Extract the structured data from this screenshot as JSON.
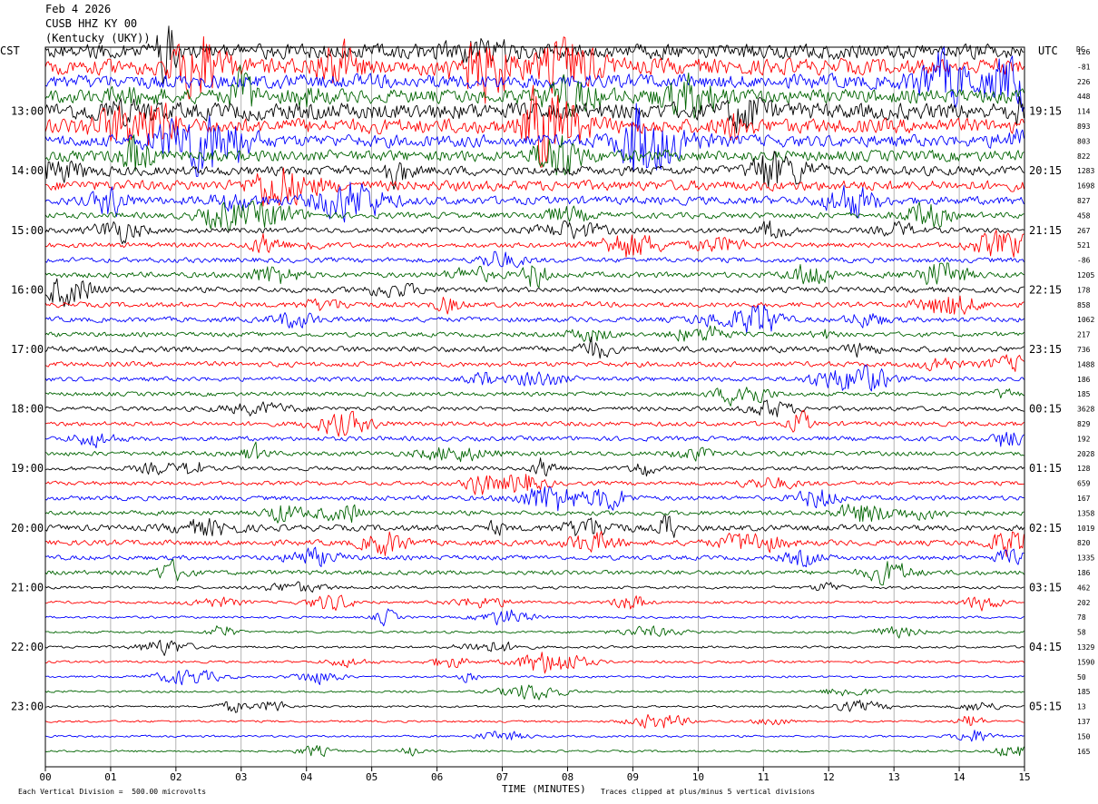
{
  "header": {
    "line1": "Feb 4 2026",
    "line2": "CUSB HHZ KY 00",
    "line3": "(Kentucky (UKY))"
  },
  "left_zone_label": "CST",
  "right_zone_label": "UTC",
  "dc_label": "DC",
  "footer": {
    "scale_note": "Each Vertical Division =  500.00 microvolts",
    "x_title": "TIME (MINUTES)",
    "clip_note": "Traces clipped at plus/minus 5 vertical divisions"
  },
  "chart_data": {
    "type": "line",
    "title": "",
    "xlabel": "TIME (MINUTES)",
    "xlim": [
      0,
      15
    ],
    "x_ticks": [
      "00",
      "01",
      "02",
      "03",
      "04",
      "05",
      "06",
      "07",
      "08",
      "09",
      "10",
      "11",
      "12",
      "13",
      "14",
      "15"
    ],
    "left_hour_labels": [
      "13:00",
      "14:00",
      "15:00",
      "16:00",
      "17:00",
      "18:00",
      "19:00",
      "20:00",
      "21:00",
      "22:00",
      "23:00"
    ],
    "right_hour_labels": [
      "19:15",
      "20:15",
      "21:15",
      "22:15",
      "23:15",
      "00:15",
      "01:15",
      "02:15",
      "03:15",
      "04:15",
      "05:15"
    ],
    "trace_colors_cycle": [
      "#000000",
      "#ff0000",
      "#0000ff",
      "#006400"
    ],
    "first_trace_color": "#000000",
    "rows_per_hour": 4,
    "dc_offsets": [
      "126",
      "-81",
      "226",
      "448",
      "114",
      "893",
      "803",
      "822",
      "1283",
      "1698",
      "827",
      "458",
      "267",
      "521",
      "-86",
      "1205",
      "178",
      "858",
      "1062",
      "217",
      "736",
      "1488",
      "186",
      "185",
      "3628",
      "829",
      "192",
      "2028",
      "128",
      "659",
      "167",
      "1358",
      "1019",
      "820",
      "1335",
      "186",
      "462",
      "202",
      "78",
      "58",
      "1329",
      "1590",
      "50",
      "185",
      "13",
      "137",
      "150",
      "165"
    ],
    "activity_level": [
      3.2,
      3.4,
      3.0,
      3.0,
      3.6,
      3.2,
      2.6,
      2.4,
      2.0,
      2.2,
      1.8,
      1.3,
      1.2,
      1.1,
      1.1,
      1.2,
      1.2,
      1.1,
      1.1,
      1.0,
      1.3,
      1.1,
      1.0,
      0.9,
      1.0,
      1.0,
      1.0,
      1.0,
      0.9,
      0.9,
      1.0,
      1.0,
      1.3,
      1.2,
      1.0,
      1.0,
      0.6,
      0.55,
      0.5,
      0.5,
      0.5,
      0.5,
      0.45,
      0.45,
      0.45,
      0.45,
      0.45,
      0.45
    ]
  }
}
